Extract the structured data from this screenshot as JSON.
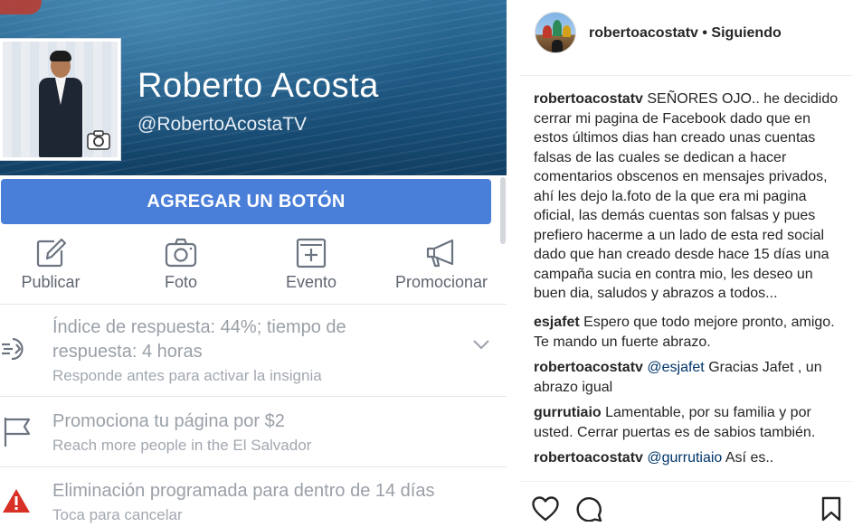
{
  "facebook": {
    "page_name": "Roberto Acosta",
    "page_handle": "@RobertoAcostaTV",
    "add_button_label": "AGREGAR UN BOTÓN",
    "actions": [
      {
        "label": "Publicar",
        "icon": "pencil-icon"
      },
      {
        "label": "Foto",
        "icon": "camera-icon"
      },
      {
        "label": "Evento",
        "icon": "calendar-plus-icon"
      },
      {
        "label": "Promocionar",
        "icon": "megaphone-icon"
      }
    ],
    "response_rate": {
      "title": "Índice de respuesta: 44%; tiempo de respuesta: 4 horas",
      "title_line1": "Índice de respuesta: 44%; tiempo de",
      "title_line2": "respuesta: 4 horas",
      "subtitle": "Responde antes para activar la insignia"
    },
    "promote": {
      "title": "Promociona tu página por $2",
      "subtitle": "Reach more people in the El Salvador"
    },
    "deletion": {
      "title": "Eliminación programada para dentro de 14 días",
      "subtitle": "Toca para cancelar",
      "alert_color": "#d93025"
    },
    "accent_color": "#4a7fd9"
  },
  "instagram": {
    "username": "robertoacostatv",
    "follow_status": "• Siguiendo",
    "caption": {
      "user": "robertoacostatv",
      "text": " SEÑORES OJO.. he decidido cerrar mi pagina de Facebook dado que en estos últimos dias han creado unas cuentas falsas de las cuales se dedican a hacer comentarios obscenos en mensajes privados, ahí les dejo la.foto de la que era mi pagina oficial, las demás cuentas son falsas y pues prefiero hacerme a un lado de esta red social dado que han creado desde hace 15 días una campaña sucia en contra mio, les deseo un buen dia, saludos y abrazos a todos..."
    },
    "comments": [
      {
        "user": "esjafet",
        "mention": "",
        "text": " Espero que todo mejore pronto, amigo. Te mando un fuerte abrazo."
      },
      {
        "user": "robertoacostatv",
        "mention": " @esjafet",
        "text": " Gracias Jafet , un abrazo igual"
      },
      {
        "user": "gurrutiaio",
        "mention": "",
        "text": " Lamentable, por su familia y por usted. Cerrar puertas es de sabios también."
      },
      {
        "user": "robertoacostatv",
        "mention": " @gurrutiaio",
        "text": " Así es.."
      }
    ],
    "action_icons": [
      "heart-icon",
      "comment-icon",
      "bookmark-icon"
    ],
    "mention_color": "#003569"
  }
}
